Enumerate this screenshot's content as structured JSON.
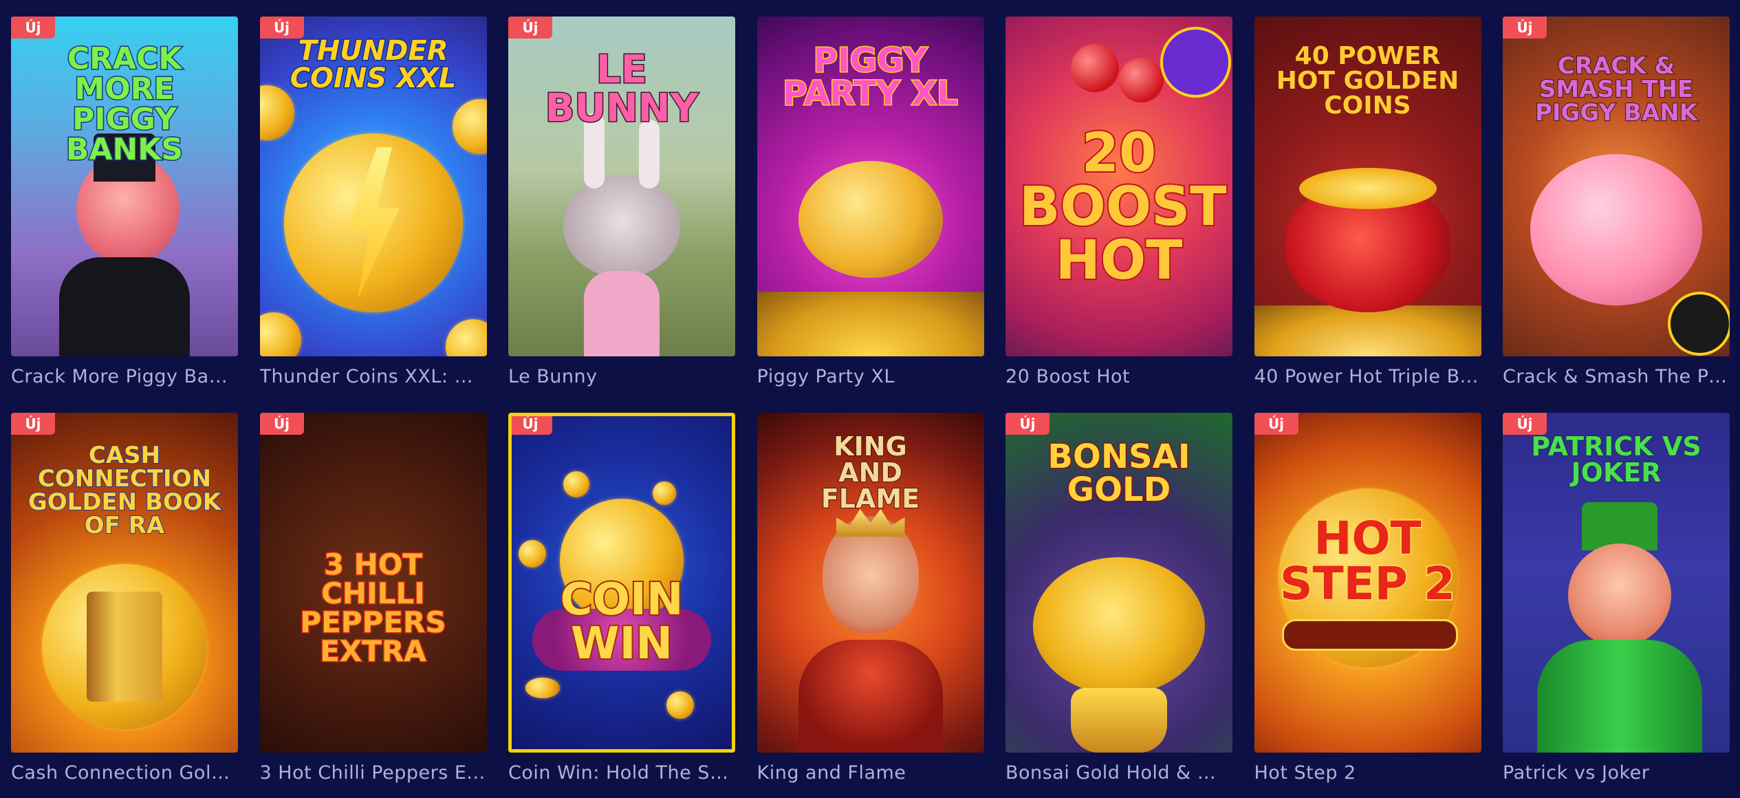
{
  "badge_text": "Új",
  "games": [
    {
      "label": "Crack More Piggy Ban...",
      "art_title": "CRACK MORE PIGGY BANKS",
      "new": true,
      "bg": "linear-gradient(180deg,#36d0f0 0%,#5fa8e0 35%,#8f6fc6 70%,#6a4a9a 100%)",
      "title_color": "#7ef04a",
      "accent": "#e83a9a"
    },
    {
      "label": "Thunder Coins XXL: H...",
      "art_title": "THUNDER COINS XXL",
      "new": true,
      "bg": "radial-gradient(circle at 50% 55%,#4fd6ff 0%,#2f7cf0 40%,#3442c8 75%,#2a2a8c 100%)",
      "title_color": "#ffd21e",
      "accent": "#ff3b2f"
    },
    {
      "label": "Le Bunny",
      "art_title": "LE BUNNY",
      "new": true,
      "bg": "linear-gradient(180deg,#a7cbc3 0%,#b7c9a4 45%,#8ba067 70%,#6d7e48 100%)",
      "title_color": "#ff5ea8",
      "accent": "#ffffff"
    },
    {
      "label": "Piggy Party XL",
      "art_title": "PIGGY PARTY XL",
      "new": false,
      "bg": "radial-gradient(circle at 50% 60%,#ff4ed1 0%,#b41fa5 40%,#6b0f7a 80%,#3d0a55 100%)",
      "title_color": "#ff55c8",
      "accent": "#ffd21e"
    },
    {
      "label": "20 Boost Hot",
      "art_title": "20 BOOST HOT",
      "new": false,
      "bg": "radial-gradient(circle at 50% 45%,#ff7a4a 0%,#e0385a 45%,#a71f5a 80%,#6c1b54 100%)",
      "title_color": "#ffc83a",
      "accent": "#6a2bd0"
    },
    {
      "label": "40 Power Hot Triple B...",
      "art_title": "40 POWER HOT GOLDEN COINS",
      "new": false,
      "bg": "radial-gradient(circle at 50% 60%,#c8322a 0%,#8e1b1b 45%,#5a1010 100%)",
      "title_color": "#ffcc33",
      "accent": "#ff3a2a"
    },
    {
      "label": "Crack & Smash The Pi...",
      "art_title": "CRACK & SMASH THE PIGGY BANK",
      "new": true,
      "bg": "radial-gradient(circle at 50% 50%,#f08a3a 0%,#b84a20 45%,#6a2a18 100%)",
      "title_color": "#d86ad8",
      "accent": "#ff8fb0"
    },
    {
      "label": "Cash Connection Gold...",
      "art_title": "CASH CONNECTION GOLDEN BOOK OF RA",
      "new": true,
      "bg": "radial-gradient(circle at 50% 72%,#ffd84a 0%,#f08b16 30%,#b8450e 60%,#5a1a0a 100%)",
      "title_color": "#ffd33a",
      "accent": "#2a86e8"
    },
    {
      "label": "3 Hot Chilli Peppers E...",
      "art_title": "3 HOT CHILLI PEPPERS EXTRA",
      "new": true,
      "bg": "radial-gradient(circle at 50% 50%,#6e2f14 0%,#4a1c0e 55%,#2a0d08 100%)",
      "title_color": "#ffb02e",
      "accent": "#e8281e"
    },
    {
      "label": "Coin Win: Hold The Sp...",
      "art_title": "COIN WIN",
      "new": true,
      "bg": "radial-gradient(circle at 50% 45%,#2a56d8 0%,#1a2ea0 50%,#10166a 100%)",
      "title_color": "#ffd84a",
      "accent": "#b0308a"
    },
    {
      "label": "King and Flame",
      "art_title": "KING AND FLAME",
      "new": false,
      "bg": "radial-gradient(circle at 50% 55%,#ff8a2a 0%,#d8451a 40%,#7a1a12 75%,#3a0a0a 100%)",
      "title_color": "#f6d89a",
      "accent": "#c8361e"
    },
    {
      "label": "Bonsai Gold Hold & Win",
      "art_title": "BONSAI GOLD",
      "new": true,
      "bg": "radial-gradient(circle at 50% 65%,#6a4aa8 0%,#3a2a6a 50%,#1f6a2a 100%)",
      "title_color": "#ffd33a",
      "accent": "#d02a2a"
    },
    {
      "label": "Hot Step 2",
      "art_title": "HOT STEP 2",
      "new": true,
      "bg": "radial-gradient(circle at 50% 55%,#ffe07a 0%,#f59a1e 35%,#d05010 70%,#7a1e08 100%)",
      "title_color": "#e8261a",
      "accent": "#ffd84a"
    },
    {
      "label": "Patrick vs Joker",
      "art_title": "PATRICK VS JOKER",
      "new": true,
      "bg": "linear-gradient(180deg,#2c2a8a 0%,#3a3aa8 45%,#2a2f8a 100%)",
      "title_color": "#4ae04a",
      "accent": "#b84ae8"
    }
  ]
}
